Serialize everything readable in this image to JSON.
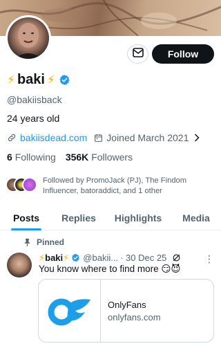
{
  "profile": {
    "display_name": "baki",
    "handle": "@bakiisback",
    "bio": "24 years old",
    "website": "bakiisdead.com",
    "joined": "Joined March 2021",
    "following_count": "6",
    "following_label": "Following",
    "followers_count": "356K",
    "followers_label": "Followers",
    "followed_by": "Followed by PromoJack (PJ), The Findom Influencer, batoraddict, and 1 other"
  },
  "actions": {
    "follow_label": "Follow"
  },
  "tabs": [
    {
      "label": "Posts",
      "active": true
    },
    {
      "label": "Replies",
      "active": false
    },
    {
      "label": "Highlights",
      "active": false
    },
    {
      "label": "Media",
      "active": false
    }
  ],
  "pinned_post": {
    "pinned_label": "Pinned",
    "author_name": "baki",
    "author_handle": "@bakii...",
    "date": "· 30 Dec 25",
    "text": "You know where to find more 😏😈",
    "card_title": "OnlyFans",
    "card_domain": "onlyfans.com"
  },
  "colors": {
    "accent": "#1d9bf0",
    "text": "#0f1419",
    "muted": "#536471",
    "bolt": "#f6b40a"
  },
  "icons": [
    "lightning-bolt-icon",
    "verified-badge-icon",
    "mail-icon",
    "link-icon",
    "calendar-icon",
    "chevron-right-icon",
    "pin-icon",
    "grok-icon",
    "more-icon",
    "onlyfans-logo"
  ]
}
